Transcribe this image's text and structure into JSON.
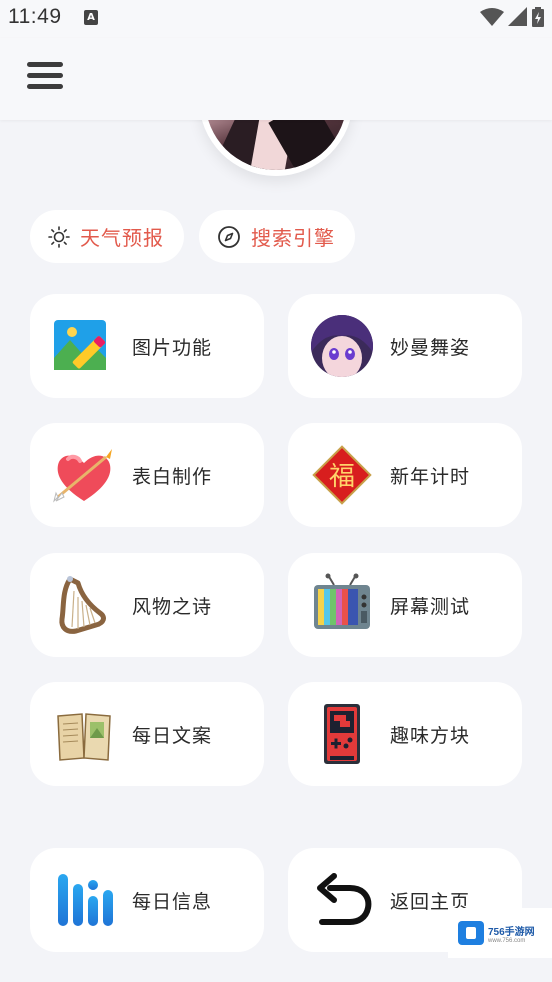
{
  "status": {
    "time": "11:49",
    "notification_icon": "a-icon",
    "icons": [
      "wifi-icon",
      "signal-icon",
      "battery-icon"
    ]
  },
  "toolbar": {
    "menu_icon": "menu-icon"
  },
  "chips": [
    {
      "label": "天气预报",
      "icon": "sun-icon"
    },
    {
      "label": "搜索引擎",
      "icon": "compass-icon"
    }
  ],
  "cards": [
    {
      "label": "图片功能",
      "icon": "image-edit-icon"
    },
    {
      "label": "妙曼舞姿",
      "icon": "anime-avatar-icon"
    },
    {
      "label": "表白制作",
      "icon": "heart-arrow-icon"
    },
    {
      "label": "新年计时",
      "icon": "fu-icon",
      "icon_text": "福"
    },
    {
      "label": "风物之诗",
      "icon": "harp-icon"
    },
    {
      "label": "屏幕测试",
      "icon": "tv-icon"
    },
    {
      "label": "每日文案",
      "icon": "book-icon"
    },
    {
      "label": "趣味方块",
      "icon": "gameboy-icon"
    },
    {
      "label": "每日信息",
      "icon": "bars-icon"
    },
    {
      "label": "返回主页",
      "icon": "return-arrow-icon"
    }
  ],
  "watermark": {
    "title": "756手游网",
    "subtitle": "www.756.com"
  },
  "colors": {
    "accent": "#e25a4c",
    "background": "#f3f4f8",
    "card": "#ffffff"
  }
}
